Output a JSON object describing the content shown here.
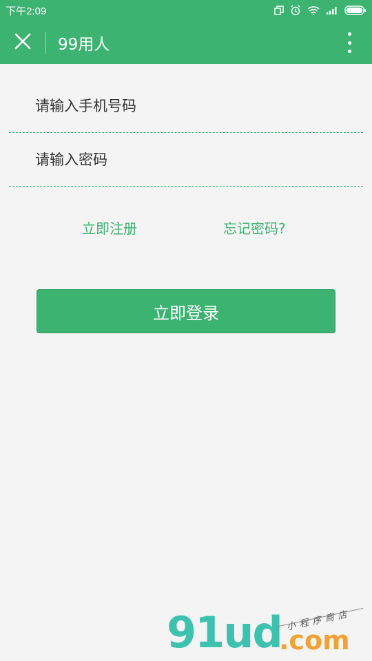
{
  "status_bar": {
    "time": "下午2:09",
    "icons": [
      "copy-icon",
      "alarm-icon",
      "wifi-icon",
      "signal-icon",
      "battery-icon"
    ]
  },
  "nav": {
    "title": "99用人",
    "close_icon": "close-icon",
    "more_icon": "more-vertical-icon"
  },
  "form": {
    "phone_placeholder": "请输入手机号码",
    "phone_value": "",
    "password_placeholder": "请输入密码",
    "password_value": ""
  },
  "links": {
    "register": "立即注册",
    "forgot": "忘记密码?"
  },
  "login_button": "立即登录",
  "watermark": {
    "brand": "91ud",
    "domain": ".com",
    "tagline": "小程序商店"
  },
  "colors": {
    "primary": "#3cb371",
    "background": "#f4f4f4",
    "text": "#333333"
  }
}
